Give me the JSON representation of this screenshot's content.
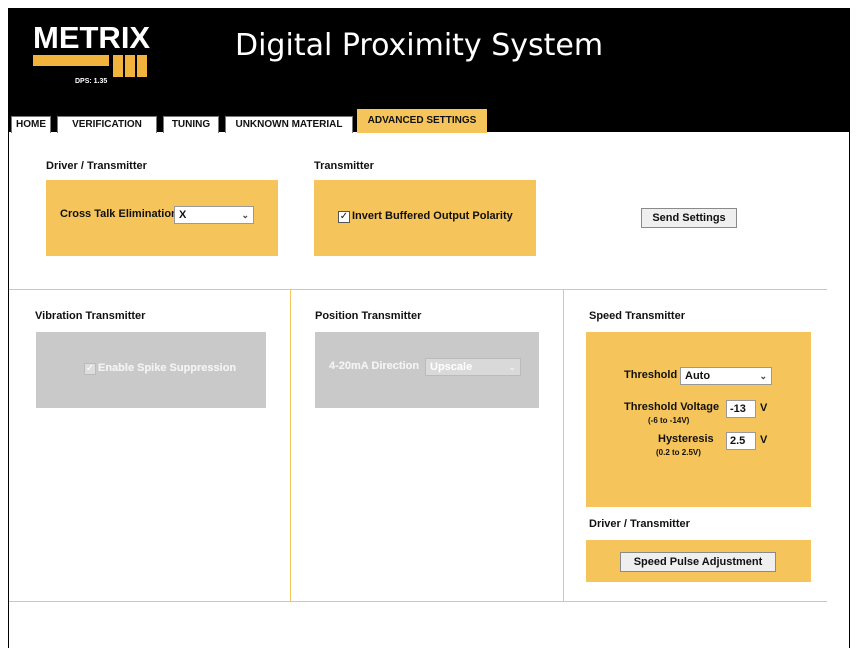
{
  "header": {
    "logo_text": "METRIX",
    "version": "DPS: 1.35",
    "title": "Digital Proximity System"
  },
  "tabs": [
    {
      "label": "HOME"
    },
    {
      "label": "VERIFICATION"
    },
    {
      "label": "TUNING"
    },
    {
      "label": "UNKNOWN MATERIAL"
    },
    {
      "label": "ADVANCED SETTINGS",
      "active": true
    }
  ],
  "driver_transmitter": {
    "title": "Driver / Transmitter",
    "cross_talk_label": "Cross Talk Elimination",
    "cross_talk_value": "X"
  },
  "transmitter": {
    "title": "Transmitter",
    "invert_label": "Invert Buffered Output Polarity",
    "invert_checked": true
  },
  "send_settings_label": "Send Settings",
  "vibration": {
    "title": "Vibration Transmitter",
    "spike_label": "Enable Spike Suppression",
    "spike_checked": true
  },
  "position": {
    "title": "Position Transmitter",
    "direction_label": "4-20mA Direction",
    "direction_value": "Upscale"
  },
  "speed": {
    "title": "Speed Transmitter",
    "threshold_label": "Threshold",
    "threshold_value": "Auto",
    "threshold_voltage_label": "Threshold Voltage",
    "threshold_voltage_range": "(-6 to -14V)",
    "threshold_voltage_value": "-13",
    "threshold_voltage_unit": "V",
    "hysteresis_label": "Hysteresis",
    "hysteresis_range": "(0.2 to 2.5V)",
    "hysteresis_value": "2.5",
    "hysteresis_unit": "V",
    "driver_title": "Driver / Transmitter",
    "pulse_button": "Speed Pulse Adjustment"
  },
  "colors": {
    "accent": "#f5c45a",
    "header_bg": "#000000",
    "disabled_panel": "#c9c9c9"
  }
}
